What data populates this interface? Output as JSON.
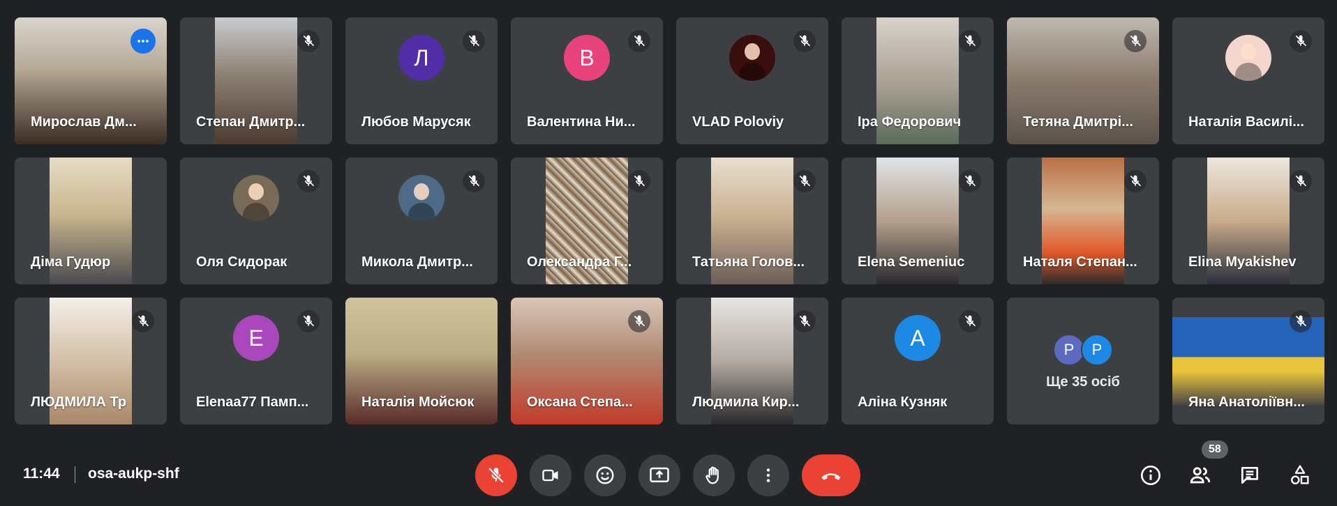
{
  "participants": [
    {
      "name": "Мирослав Дм...",
      "kind": "video",
      "bg": "linear-gradient(180deg,#d9d4cc 0%,#b6aa98 40%,#3a2c22 100%)",
      "full": true
    },
    {
      "name": "Степан Дмитр...",
      "kind": "video",
      "bg": "linear-gradient(180deg,#c9ccd0 0%,#8d8174 45%,#4b3a30 100%)"
    },
    {
      "name": "Любов Марусяк",
      "kind": "initial",
      "initial": "Л",
      "color": "#512da8"
    },
    {
      "name": "Валентина Ни...",
      "kind": "initial",
      "initial": "В",
      "color": "#e8437a"
    },
    {
      "name": "VLAD Poloviy",
      "kind": "photo",
      "color": "#3b0e0e"
    },
    {
      "name": "Іра Федорович",
      "kind": "video",
      "bg": "linear-gradient(180deg,#d8d2ca 0%,#a89e92 55%,#5b6b5a 100%)"
    },
    {
      "name": "Тетяна Дмитрі...",
      "kind": "video",
      "bg": "linear-gradient(180deg,#bfb9b0 0%,#8a7a6c 50%,#5a524a 100%)",
      "full": true
    },
    {
      "name": "Наталія Василі...",
      "kind": "photo",
      "color": "#f4d6cf"
    },
    {
      "name": "Діма Гудюр",
      "kind": "video",
      "bg": "linear-gradient(180deg,#e6dcc6 0%,#c9b58f 45%,#4a4b4f 100%)"
    },
    {
      "name": "Оля Сидорак",
      "kind": "photo",
      "color": "#7a6b58"
    },
    {
      "name": "Микола Дмитр...",
      "kind": "photo",
      "color": "#4e6a86"
    },
    {
      "name": "Олександра Г...",
      "kind": "video",
      "bg": "repeating-linear-gradient(45deg,#6b5034 0px,#e6ddd0 6px,#7d6145 12px,#cfc3b2 18px)"
    },
    {
      "name": "Татьяна Голов...",
      "kind": "video",
      "bg": "linear-gradient(180deg,#e9dfcf 0%,#c7ad8e 50%,#6a5e58 100%)"
    },
    {
      "name": "Elena Semeniuc",
      "kind": "video",
      "bg": "linear-gradient(180deg,#dfe3e6 0%,#b5a08c 50%,#2a2a2e 100%)"
    },
    {
      "name": "Наталя Степан...",
      "kind": "video",
      "bg": "linear-gradient(180deg,#b87045 0%,#d6b692 40%,#e0592a 75%,#2c2c2c 100%)"
    },
    {
      "name": "Elina Myakishev",
      "kind": "video",
      "bg": "linear-gradient(180deg,#ece7df 0%,#c9ab8a 50%,#2b2f3a 100%)"
    },
    {
      "name": "ЛЮДМИЛА Тр",
      "kind": "video",
      "bg": "linear-gradient(180deg,#f3efe8 0%,#d3c0a8 50%,#a98768 100%)"
    },
    {
      "name": "Elenaa77 Памп...",
      "kind": "initial",
      "initial": "E",
      "color": "#ab47bc"
    },
    {
      "name": "Наталія Мойсюк",
      "kind": "video",
      "bg": "linear-gradient(180deg,#cfc49c 0%,#b9ad84 45%,#5a2a2a 100%)",
      "full": true
    },
    {
      "name": "Оксана Степа...",
      "kind": "video",
      "bg": "linear-gradient(180deg,#d9c6b9 0%,#b08a73 45%,#c23a2a 100%)",
      "full": true
    },
    {
      "name": "Людмила Кир...",
      "kind": "video",
      "bg": "linear-gradient(180deg,#e8e5e2 0%,#b4aaa3 50%,#2a2a2a 100%)"
    },
    {
      "name": "Аліна Кузняк",
      "kind": "initial",
      "initial": "A",
      "color": "#1e88e5"
    },
    {
      "name": "",
      "kind": "more",
      "initials": [
        "P",
        "P"
      ],
      "colors": [
        "#5c6bc0",
        "#1e88e5"
      ],
      "label": "Ще 35 осіб"
    },
    {
      "name": "Яна Анатоліївн...",
      "kind": "video",
      "bg": "linear-gradient(180deg,#2563b8 0%,#2563b8 45%,#e7c43b 46%,#e7c43b 62%,#4a4644 100%)",
      "wide": true
    }
  ],
  "meeting": {
    "time": "11:44",
    "code": "osa-aukp-shf",
    "participant_count": "58"
  },
  "controls": [
    "mic-off",
    "camera",
    "reactions",
    "present-screen",
    "raise-hand",
    "more-options",
    "leave-call"
  ],
  "colors": {
    "accent": "#1a73e8",
    "danger": "#ea4335",
    "tile": "#3c4043",
    "bg": "#202124"
  }
}
